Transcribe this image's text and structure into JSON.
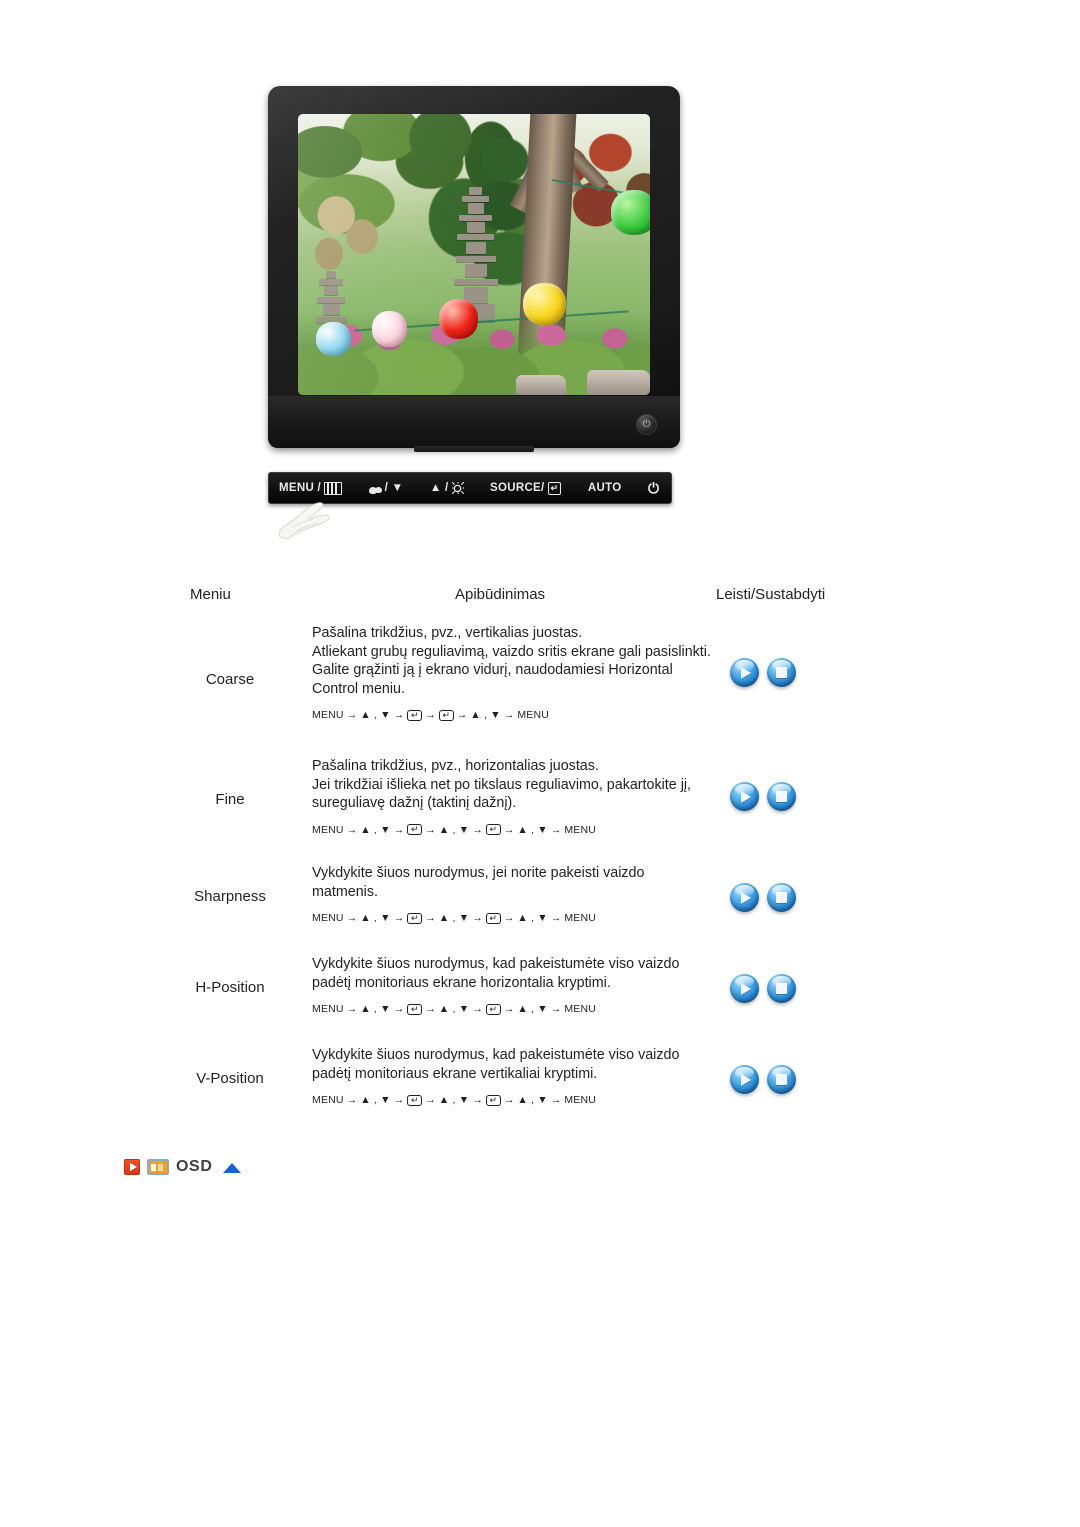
{
  "illustration": {
    "monitor_alt": "LCD monitor displaying a garden scene with stone pagoda and colorful paper lanterns",
    "power_led_label": "⏻",
    "control_panel": {
      "buttons": [
        {
          "label": "MENU /",
          "icon": "menu-grid-icon"
        },
        {
          "label": "/ ▼",
          "icon": "image-adjust-icon"
        },
        {
          "label": "▲ /",
          "icon": "brightness-sun-icon"
        },
        {
          "label": "SOURCE/",
          "icon": "enter-key-icon"
        },
        {
          "label": "AUTO",
          "icon": ""
        },
        {
          "label": "",
          "icon": "power-icon"
        }
      ]
    },
    "hand_cursor": "hand-pointing-icon"
  },
  "table": {
    "headers": {
      "menu": "Meniu",
      "description": "Apibūdinimas",
      "play_stop": "Leisti/Sustabdyti"
    },
    "rows": [
      {
        "menu": "Coarse",
        "description": "Pašalina trikdžius, pvz., vertikalias juostas.\nAtliekant grubų reguliavimą, vaizdo sritis ekrane gali pasislinkti. Galite grąžinti ją į ekrano vidurį, naudodamiesi Horizontal Control meniu.",
        "keyseq": [
          "MENU",
          "→",
          "▲ , ▼",
          "→",
          "ENTER",
          "→",
          "ENTER",
          "→",
          "▲ , ▼",
          "→",
          "MENU"
        ],
        "play_label": "Leisti",
        "stop_label": "Sustabdyti"
      },
      {
        "menu": "Fine",
        "description": "Pašalina trikdžius, pvz., horizontalias juostas.\nJei trikdžiai išlieka net po tikslaus reguliavimo, pakartokite jį, sureguliavę dažnį (taktinį dažnį).",
        "keyseq": [
          "MENU",
          "→",
          "▲ , ▼",
          "→",
          "ENTER",
          "→",
          "▲ , ▼",
          "→",
          "ENTER",
          "→",
          "▲ , ▼",
          "→",
          "MENU"
        ],
        "play_label": "Leisti",
        "stop_label": "Sustabdyti"
      },
      {
        "menu": "Sharpness",
        "description": "Vykdykite šiuos nurodymus, jei norite pakeisti vaizdo matmenis.",
        "keyseq": [
          "MENU",
          "→",
          "▲ , ▼",
          "→",
          "ENTER",
          "→",
          "▲ , ▼",
          "→",
          "ENTER",
          "→",
          "▲ , ▼",
          "→",
          "MENU"
        ],
        "play_label": "Leisti",
        "stop_label": "Sustabdyti"
      },
      {
        "menu": "H-Position",
        "description": "Vykdykite šiuos nurodymus, kad pakeistumėte viso vaizdo padėtį monitoriaus ekrane horizontalia kryptimi.",
        "keyseq": [
          "MENU",
          "→",
          "▲ , ▼",
          "→",
          "ENTER",
          "→",
          "▲ , ▼",
          "→",
          "ENTER",
          "→",
          "▲ , ▼",
          "→",
          "MENU"
        ],
        "play_label": "Leisti",
        "stop_label": "Sustabdyti"
      },
      {
        "menu": "V-Position",
        "description": "Vykdykite šiuos nurodymus, kad pakeistumėte viso vaizdo padėtį monitoriaus ekrane vertikaliai kryptimi.",
        "keyseq": [
          "MENU",
          "→",
          "▲ , ▼",
          "→",
          "ENTER",
          "→",
          "▲ , ▼",
          "→",
          "ENTER",
          "→",
          "▲ , ▼",
          "→",
          "MENU"
        ],
        "play_label": "Leisti",
        "stop_label": "Sustabdyti"
      }
    ]
  },
  "footer": {
    "label": "OSD",
    "play_icon": "play-square-icon",
    "osd_icon": "osd-monitor-icon",
    "up_icon": "scroll-up-triangle-icon"
  },
  "colors": {
    "accent_orange": "#f1a02a",
    "accent_red": "#e8441f",
    "accent_blue": "#1763d8",
    "orb_blue": "#2e8fd8",
    "text": "#231f20"
  }
}
